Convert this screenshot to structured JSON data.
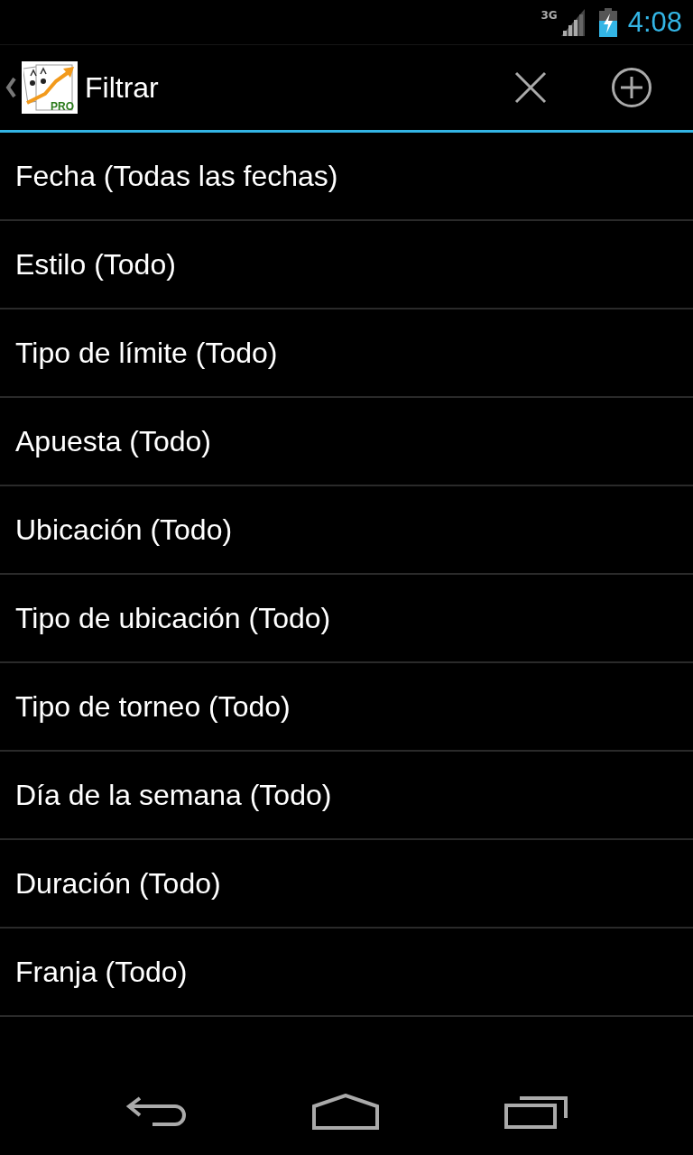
{
  "status_bar": {
    "network": "3G",
    "time": "4:08"
  },
  "action_bar": {
    "logo_badge": "PRO",
    "title": "Filtrar"
  },
  "filters": [
    {
      "label": "Fecha (Todas las fechas)"
    },
    {
      "label": "Estilo (Todo)"
    },
    {
      "label": "Tipo de límite (Todo)"
    },
    {
      "label": "Apuesta (Todo)"
    },
    {
      "label": "Ubicación (Todo)"
    },
    {
      "label": "Tipo de ubicación (Todo)"
    },
    {
      "label": "Tipo de torneo (Todo)"
    },
    {
      "label": "Día de la semana (Todo)"
    },
    {
      "label": "Duración (Todo)"
    },
    {
      "label": "Franja (Todo)"
    }
  ]
}
